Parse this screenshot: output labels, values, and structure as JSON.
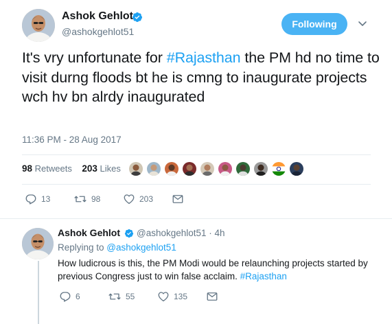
{
  "main_tweet": {
    "author_name": "Ashok Gehlot",
    "handle": "@ashokgehlot51",
    "follow_label": "Following",
    "text_before_hashtag": "It's vry unfortunate for ",
    "hashtag": "#Rajasthan",
    "text_after_hashtag": " the PM hd no time to visit durng floods bt he is cmng to inaugurate projects wch hv bn alrdy inaugurated",
    "timestamp": "11:36 PM - 28 Aug 2017",
    "retweets_count": "98",
    "retweets_label": "Retweets",
    "likes_count": "203",
    "likes_label": "Likes",
    "actions": {
      "reply_count": "13",
      "retweet_count": "98",
      "like_count": "203"
    }
  },
  "reply_tweet": {
    "author_name": "Ashok Gehlot",
    "handle_time": "@ashokgehlot51 · 4h",
    "replying_prefix": "Replying to ",
    "replying_handle": "@ashokgehlot51",
    "text": "How ludicrous is this, the PM Modi would be relaunching projects started by previous Congress just to win false acclaim. ",
    "hashtag": "#Rajasthan",
    "actions": {
      "reply_count": "6",
      "retweet_count": "55",
      "like_count": "135"
    }
  },
  "icons": {
    "verified": "verified-badge-icon",
    "caret": "chevron-down-icon",
    "reply": "reply-icon",
    "retweet": "retweet-icon",
    "like": "heart-icon",
    "dm": "envelope-icon"
  },
  "colors": {
    "accent": "#1da1f2",
    "follow_button": "#4ab3f4",
    "secondary_text": "#657786",
    "divider": "#e6ecf0"
  }
}
